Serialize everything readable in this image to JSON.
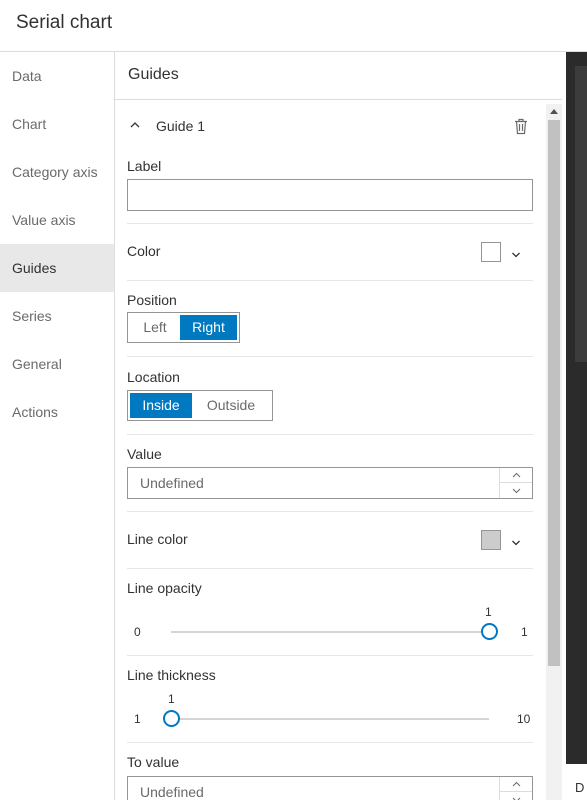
{
  "app": {
    "title": "Serial chart"
  },
  "sidebar": {
    "items": [
      {
        "label": "Data"
      },
      {
        "label": "Chart"
      },
      {
        "label": "Category axis"
      },
      {
        "label": "Value axis"
      },
      {
        "label": "Guides",
        "active": true
      },
      {
        "label": "Series"
      },
      {
        "label": "General"
      },
      {
        "label": "Actions"
      }
    ]
  },
  "panel": {
    "title": "Guides",
    "guide": {
      "name": "Guide 1",
      "label": {
        "caption": "Label",
        "value": ""
      },
      "color": {
        "caption": "Color",
        "value": "#ffffff"
      },
      "position": {
        "caption": "Position",
        "options": [
          "Left",
          "Right"
        ],
        "selected": "Right"
      },
      "location": {
        "caption": "Location",
        "options": [
          "Inside",
          "Outside"
        ],
        "selected": "Inside"
      },
      "value": {
        "caption": "Value",
        "placeholder": "Undefined"
      },
      "line_color": {
        "caption": "Line color",
        "value": "#cccccc"
      },
      "line_opacity": {
        "caption": "Line opacity",
        "min": "0",
        "max": "1",
        "current": "1",
        "fraction": 1.0
      },
      "line_thickness": {
        "caption": "Line thickness",
        "min": "1",
        "max": "10",
        "current": "1",
        "fraction": 0.0
      },
      "to_value": {
        "caption": "To value",
        "placeholder": "Undefined"
      }
    }
  },
  "icons": {
    "collapse": "chevron-up-icon",
    "delete": "trash-icon",
    "dropdown": "chevron-down-icon"
  },
  "colors": {
    "accent": "#0079c1"
  },
  "right_edge": {
    "letter": "D"
  }
}
